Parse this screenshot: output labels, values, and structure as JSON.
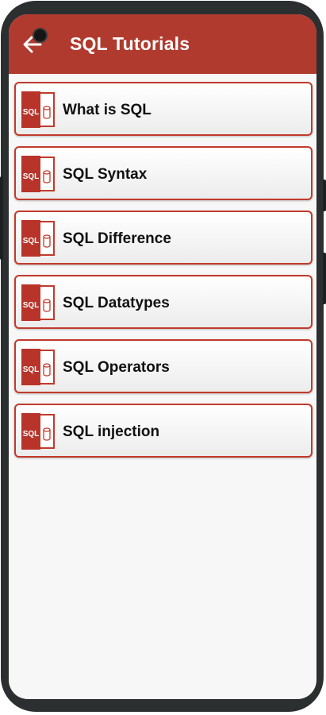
{
  "appbar": {
    "title": "SQL Tutorials",
    "back_icon": "arrow-left-icon",
    "color": "#b03a2e"
  },
  "list": {
    "accent": "#c23a2c",
    "item_icon": "sql-file-icon",
    "icon_text": "SQL",
    "items": [
      {
        "label": "What is SQL"
      },
      {
        "label": "SQL Syntax"
      },
      {
        "label": "SQL Difference"
      },
      {
        "label": "SQL Datatypes"
      },
      {
        "label": "SQL Operators"
      },
      {
        "label": "SQL injection"
      }
    ]
  }
}
